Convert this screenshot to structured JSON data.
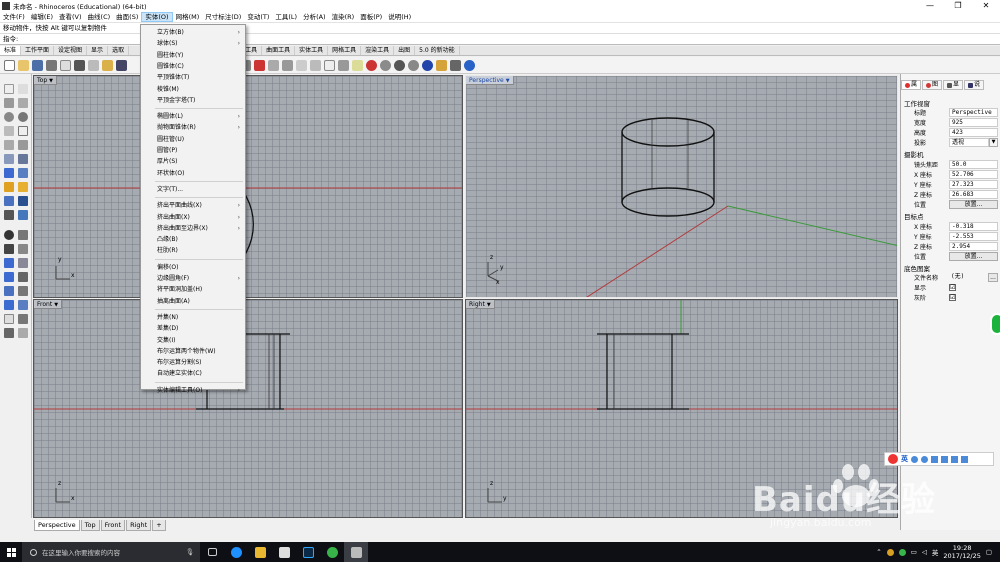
{
  "window": {
    "title": "未命名 - Rhinoceros (Educational) (64-bit)",
    "min": "—",
    "max": "❐",
    "close": "✕"
  },
  "menubar": [
    "文件(F)",
    "编辑(E)",
    "查看(V)",
    "曲线(C)",
    "曲面(S)",
    "实体(O)",
    "网格(M)",
    "尺寸标注(D)",
    "变动(T)",
    "工具(L)",
    "分析(A)",
    "渲染(R)",
    "面板(P)",
    "说明(H)"
  ],
  "command": {
    "history": "移动物件，快按 Alt 键可以复制物件",
    "prompt": "指令:"
  },
  "toolbar_tabs": [
    "标准",
    "工作平面",
    "设定视图",
    "显示",
    "选取",
    "工作视窗配置",
    "可见性",
    "变动",
    "曲线工具",
    "曲面工具",
    "实体工具",
    "网格工具",
    "渲染工具",
    "出图",
    "5.0 的新功能"
  ],
  "toolbar_tabs_visible_after_menu": [
    "曲线工具",
    "曲面工具",
    "实体工具",
    "网格工具",
    "渲染工具",
    "出图",
    "5.0 的新功能"
  ],
  "viewports": {
    "top": {
      "label": "Top"
    },
    "perspective": {
      "label": "Perspective"
    },
    "front": {
      "label": "Front"
    },
    "right": {
      "label": "Right"
    }
  },
  "axis": {
    "x": "x",
    "y": "y",
    "z": "z"
  },
  "viewport_tabs": [
    "Perspective",
    "Top",
    "Front",
    "Right",
    "+"
  ],
  "panel": {
    "tabs": [
      "属",
      "图",
      "显",
      "说"
    ],
    "section_viewport": "工作视窗",
    "rows_viewport": [
      {
        "k": "标题",
        "v": "Perspective"
      },
      {
        "k": "宽度",
        "v": "925"
      },
      {
        "k": "高度",
        "v": "423"
      },
      {
        "k": "投影",
        "v": "透视"
      }
    ],
    "section_camera": "摄影机",
    "rows_camera": [
      {
        "k": "镜头焦距",
        "v": "50.0"
      },
      {
        "k": "X 座标",
        "v": "52.706"
      },
      {
        "k": "Y 座标",
        "v": "27.323"
      },
      {
        "k": "Z 座标",
        "v": "26.683"
      },
      {
        "k": "位置",
        "v": "放置..."
      }
    ],
    "section_target": "目标点",
    "rows_target": [
      {
        "k": "X 座标",
        "v": "-0.318"
      },
      {
        "k": "Y 座标",
        "v": "-2.553"
      },
      {
        "k": "Z 座标",
        "v": "2.954"
      },
      {
        "k": "位置",
        "v": "放置..."
      }
    ],
    "section_wallpaper": "底色图案",
    "rows_wallpaper": [
      {
        "k": "文件名称",
        "v": "(无)",
        "btn": "..."
      },
      {
        "k": "显示",
        "v": "☑"
      },
      {
        "k": "灰阶",
        "v": "☑"
      }
    ]
  },
  "solid_menu": [
    {
      "label": "立方体(B)",
      "sub": true
    },
    {
      "label": "球体(S)",
      "sub": true
    },
    {
      "label": "圆柱体(Y)"
    },
    {
      "label": "圆锥体(C)"
    },
    {
      "label": "平顶锥体(T)"
    },
    {
      "label": "棱锥(M)"
    },
    {
      "label": "平顶金字塔(T)"
    },
    {
      "sep": true
    },
    {
      "label": "椭圆体(L)",
      "sub": true
    },
    {
      "label": "抛物面锥体(R)",
      "sub": true
    },
    {
      "label": "圆柱管(U)"
    },
    {
      "label": "圆管(P)"
    },
    {
      "label": "厚片(S)"
    },
    {
      "label": "环状体(O)"
    },
    {
      "sep": true
    },
    {
      "label": "文字(T)..."
    },
    {
      "sep": true
    },
    {
      "label": "挤出平面曲线(X)",
      "sub": true
    },
    {
      "label": "挤出曲面(X)",
      "sub": true
    },
    {
      "label": "挤出曲面至边界(X)",
      "sub": true
    },
    {
      "label": "凸缘(B)"
    },
    {
      "label": "柱肋(R)"
    },
    {
      "sep": true
    },
    {
      "label": "偏移(O)"
    },
    {
      "label": "边缘圆角(F)",
      "sub": true
    },
    {
      "label": "将平面洞加盖(H)"
    },
    {
      "label": "抽离曲面(A)"
    },
    {
      "sep": true
    },
    {
      "label": "并集(N)"
    },
    {
      "label": "差集(D)"
    },
    {
      "label": "交集(I)"
    },
    {
      "label": "布尔运算两个物件(W)"
    },
    {
      "label": "布尔运算分割(S)"
    },
    {
      "label": "自动建立实体(C)"
    },
    {
      "sep": true
    },
    {
      "label": "实体编辑工具(O)",
      "sub": true
    }
  ],
  "taskbar": {
    "search_placeholder": "在这里输入你要搜索的内容",
    "time": "19:28",
    "date": "2017/12/25",
    "ime_label": "英"
  },
  "watermark": {
    "brand": "Baidu经验",
    "url": "jingyan.baidu.com"
  },
  "colors": {
    "viewport_bg": "#a6abb2",
    "grid": "#7d828a",
    "x_axis": "#b33a3a",
    "y_axis": "#3a9a3a",
    "menu_hover": "#cce4f7"
  }
}
